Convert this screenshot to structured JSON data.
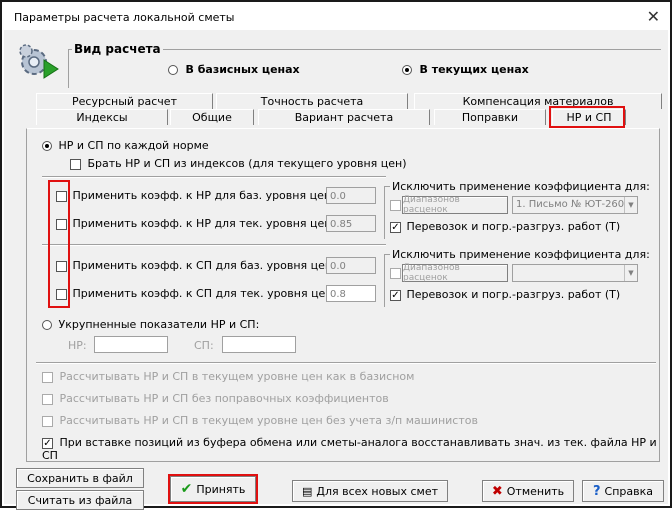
{
  "window": {
    "title": "Параметры расчета локальной сметы",
    "close_glyph": "✕"
  },
  "price_type": {
    "label": "Вид расчета",
    "base_label": "В базисных ценах",
    "current_label": "В текущих ценах",
    "selected": "current"
  },
  "tabs_back": [
    "Ресурсный расчет",
    "Точность расчета",
    "Компенсация материалов"
  ],
  "tabs_front": [
    "Индексы",
    "Общие",
    "Вариант расчета",
    "Поправки",
    "НР и СП"
  ],
  "active_tab": "НР и СП",
  "nr": {
    "per_norm_label": "НР и СП по каждой норме",
    "from_indices_label": "Брать НР и СП из индексов (для текущего уровня цен)",
    "row1_label": "Применить коэфф. к НР для баз. уровня цен:",
    "row1_value": "0.0",
    "row2_label": "Применить коэфф. к НР для тек. уровня цен:",
    "row2_value": "0.85",
    "row3_label": "Применить коэфф. к СП для баз. уровня цен:",
    "row3_value": "0.0",
    "row4_label": "Применить коэфф. к СП для тек. уровня цен:",
    "row4_value": "0.8",
    "exclude1_label": "Исключить применение коэффициента для:",
    "ranges_button": "Диапазонов расценок",
    "combo1_value": "1. Письмо № ЮТ-260",
    "transport1_label": "Перевозок и погр.-разгруз. работ (Т)",
    "exclude2_label": "Исключить применение коэффициента для:",
    "combo2_value": "",
    "transport2_label": "Перевозок и погр.-разгруз. работ (Т)",
    "aggregate_label": "Укрупненные показатели НР и СП:",
    "nr_label": "НР:",
    "sp_label": "СП:"
  },
  "options": {
    "opt1": "Рассчитывать НР и СП в текущем уровне цен как в базисном",
    "opt2": "Рассчитывать НР и СП без поправочных коэффициентов",
    "opt3": "Рассчитывать НР и СП в текущем уровне цен без учета з/п машинистов",
    "opt4": "При вставке позиций из буфера обмена или сметы-аналога восстанавливать знач. из тек. файла НР и СП"
  },
  "footer": {
    "save_file": "Сохранить в файл",
    "load_file": "Считать из файла",
    "accept": "Принять",
    "for_all_new": "Для всех новых смет",
    "cancel": "Отменить",
    "help": "Справка"
  },
  "colors": {
    "highlight_red": "#e01010",
    "dialog_bg": "#f0f0f0",
    "check_green": "#1a9a1a",
    "cancel_red": "#c00000",
    "help_blue": "#1a5fc8"
  }
}
